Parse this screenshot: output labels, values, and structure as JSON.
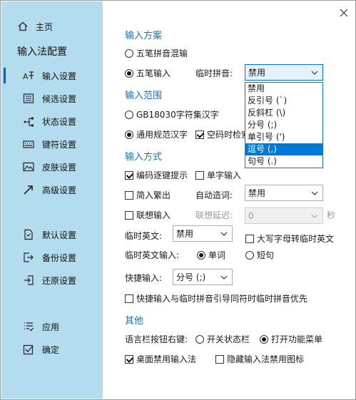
{
  "sidebar": {
    "home": "主页",
    "title": "输入法配置",
    "items": [
      {
        "label": "输入设置",
        "icon": "input-settings-icon"
      },
      {
        "label": "候选设置",
        "icon": "candidate-list-icon"
      },
      {
        "label": "状态设置",
        "icon": "status-icon"
      },
      {
        "label": "键符设置",
        "icon": "keyboard-icon"
      },
      {
        "label": "皮肤设置",
        "icon": "image-icon"
      },
      {
        "label": "高级设置",
        "icon": "arrow-icon"
      }
    ],
    "tools": [
      {
        "label": "默认设置",
        "icon": "document-icon"
      },
      {
        "label": "备份设置",
        "icon": "export-icon"
      },
      {
        "label": "还原设置",
        "icon": "import-icon"
      }
    ],
    "actions": [
      {
        "label": "应用",
        "icon": "list-check-icon"
      },
      {
        "label": "确定",
        "icon": "checkbox-icon"
      }
    ]
  },
  "scheme": {
    "header": "输入方案",
    "opt_pinyin": "五笔拼音混输",
    "opt_wubi": "五笔输入",
    "temp_pinyin_label": "临时拼音:",
    "temp_pinyin_value": "禁用",
    "dropdown_options": [
      "禁用",
      "反引号 (`)",
      "反斜杠 (\\)",
      "分号 (;)",
      "单引号 (')",
      "逗号 (,)",
      "句号 (.)"
    ]
  },
  "range": {
    "header": "输入范围",
    "opt_gb": "GB18030字符集汉字",
    "opt_common": "通用规范汉字",
    "empty_code": "空码时检索"
  },
  "method": {
    "header": "输入方式",
    "encode_hint": "编码逐键提示",
    "single_char": "单字输入",
    "simp_trad": "简入繁出",
    "auto_word_label": "自动造词:",
    "auto_word_value": "禁用",
    "assoc_input": "联想输入",
    "assoc_delay_label": "联想延迟:",
    "assoc_delay_value": "0",
    "assoc_delay_unit": "秒",
    "temp_en_label": "临时英文:",
    "temp_en_value": "禁用",
    "caps_to_en": "大写字母转临时英文",
    "temp_en_input_label": "临时英文输入:",
    "opt_word": "单词",
    "opt_sentence": "短句",
    "quick_input_label": "快捷输入:",
    "quick_input_value": "分号 (;)",
    "quick_priority": "快捷输入与临时拼音引导同符时临时拼音优先"
  },
  "other": {
    "header": "其他",
    "right_click_label": "语言栏按钮右键:",
    "opt_toggle": "开关状态栏",
    "opt_menu": "打开功能菜单",
    "desktop_disable": "桌面禁用输入法",
    "hide_icon": "隐藏输入法禁用图标"
  },
  "colors": {
    "sidebar_bg": "#b3dcef",
    "section_header": "#1f6fb5",
    "accent": "#0078d7"
  }
}
